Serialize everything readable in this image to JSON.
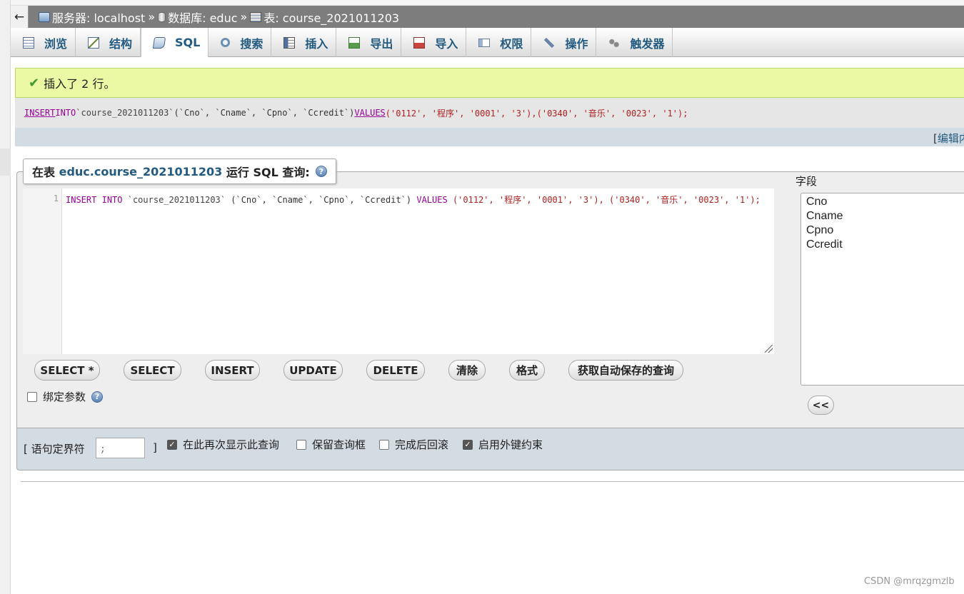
{
  "breadcrumb": {
    "back_glyph": "←",
    "server": "服务器: localhost",
    "database": "数据库: educ",
    "table": "表: course_2021011203",
    "separator": "»"
  },
  "tabs": [
    {
      "label": "浏览",
      "icon": "browse-icon"
    },
    {
      "label": "结构",
      "icon": "structure-icon"
    },
    {
      "label": "SQL",
      "icon": "sql-icon",
      "active": true
    },
    {
      "label": "搜索",
      "icon": "search-icon"
    },
    {
      "label": "插入",
      "icon": "insert-icon"
    },
    {
      "label": "导出",
      "icon": "export-icon"
    },
    {
      "label": "导入",
      "icon": "import-icon"
    },
    {
      "label": "权限",
      "icon": "privileges-icon"
    },
    {
      "label": "操作",
      "icon": "operations-icon"
    },
    {
      "label": "触发器",
      "icon": "triggers-icon"
    }
  ],
  "result": {
    "message": "插入了 2 行。",
    "sql_insert": "INSERT",
    "sql_into": "INTO",
    "sql_table": "`course_2021011203`",
    "sql_columns": "(`Cno`, `Cname`, `Cpno`, `Ccredit`)",
    "sql_values": "VALUES",
    "sql_row1": "('0112', '程序', '0001', '3'),",
    "sql_row2": "('0340', '音乐', '0023', '1');",
    "edit_open": "[",
    "edit_link": "编辑内"
  },
  "query_box": {
    "legend_prefix": "在表",
    "legend_table": "educ.course_2021011203",
    "legend_suffix": "运行 SQL 查询:",
    "help_glyph": "?",
    "line_number": "1",
    "code": {
      "insert": "INSERT",
      "into": "INTO",
      "table": "`course_2021011203`",
      "columns": "(`Cno`, `Cname`, `Cpno`, `Ccredit`)",
      "values": "VALUES",
      "row1": "('0112', '程序', '0001', '3'),",
      "row2": "('0340', '音乐', '0023', '1');"
    },
    "buttons": [
      "SELECT *",
      "SELECT",
      "INSERT",
      "UPDATE",
      "DELETE",
      "清除",
      "格式",
      "获取自动保存的查询"
    ],
    "bind_params_label": "绑定参数",
    "fields_label": "字段",
    "fields": [
      "Cno",
      "Cname",
      "Cpno",
      "Ccredit"
    ],
    "insert_column_button": "<<"
  },
  "options": {
    "delimiter_label": "[ 语句定界符",
    "delimiter_value": ";",
    "delimiter_close": "]",
    "show_again": {
      "label": "在此再次显示此查询",
      "checked": true
    },
    "retain_box": {
      "label": "保留查询框",
      "checked": false
    },
    "rollback": {
      "label": "完成后回滚",
      "checked": false
    },
    "foreign_keys": {
      "label": "启用外键约束",
      "checked": true
    }
  },
  "watermark": "CSDN @mrqzgmzlb",
  "colors": {
    "success_bg": "#ebf8a4",
    "breadcrumb_bg": "#7d7d7d",
    "link": "#235a81",
    "keyword": "#990099",
    "string": "#b31f1f"
  }
}
